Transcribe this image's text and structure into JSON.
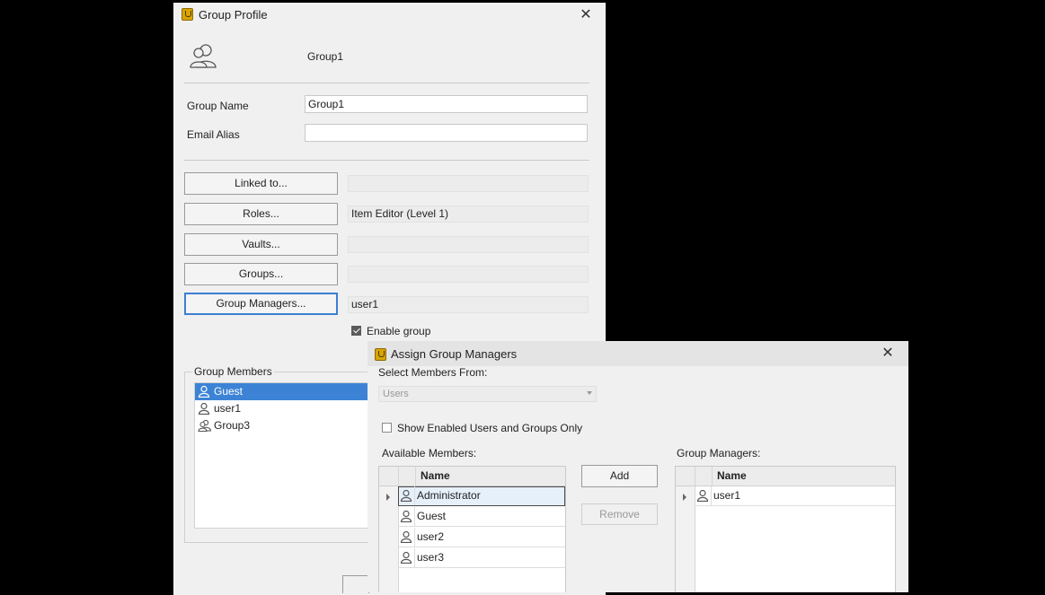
{
  "group_profile": {
    "title": "Group Profile",
    "header_name": "Group1",
    "group_name_label": "Group Name",
    "group_name_value": "Group1",
    "email_alias_label": "Email Alias",
    "email_alias_value": "",
    "buttons": [
      {
        "label": "Linked to...",
        "value": ""
      },
      {
        "label": "Roles...",
        "value": "Item Editor (Level 1)"
      },
      {
        "label": "Vaults...",
        "value": ""
      },
      {
        "label": "Groups...",
        "value": ""
      },
      {
        "label": "Group Managers...",
        "value": "user1"
      }
    ],
    "enable_group_label": "Enable group",
    "enable_group_checked": true,
    "group_members_label": "Group Members",
    "members": [
      {
        "name": "Guest",
        "type": "user",
        "selected": true
      },
      {
        "name": "user1",
        "type": "user",
        "selected": false
      },
      {
        "name": "Group3",
        "type": "group",
        "selected": false
      }
    ],
    "icons": {
      "close": "close-icon",
      "app": "app-icon",
      "group": "group-icon",
      "user": "user-icon"
    }
  },
  "assign_managers": {
    "title": "Assign Group Managers",
    "select_from_label": "Select Members From:",
    "select_from_value": "Users",
    "show_enabled_label": "Show Enabled Users and Groups Only",
    "show_enabled_checked": false,
    "available_label": "Available Members:",
    "available_column": "Name",
    "available": [
      "Administrator",
      "Guest",
      "user2",
      "user3"
    ],
    "add_label": "Add",
    "remove_label": "Remove",
    "managers_label": "Group Managers:",
    "managers_column": "Name",
    "managers": [
      "user1"
    ]
  },
  "colors": {
    "selection": "#3c83d6",
    "focus_border": "#3b7fd4",
    "app_icon": "#d9a400"
  }
}
